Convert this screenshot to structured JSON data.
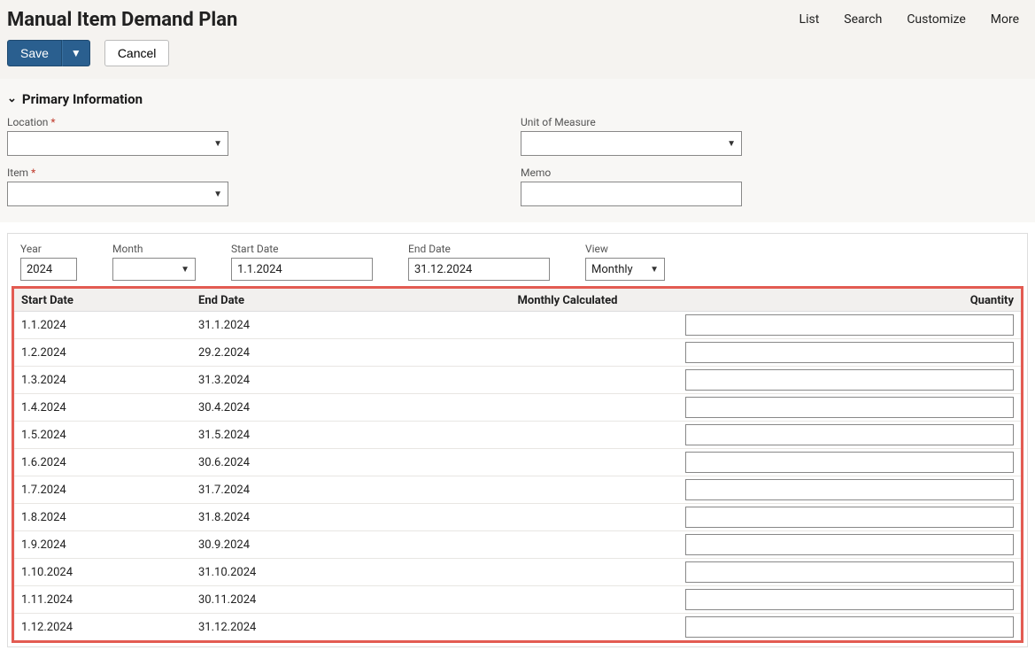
{
  "header": {
    "title": "Manual Item Demand Plan",
    "links": [
      "List",
      "Search",
      "Customize",
      "More"
    ],
    "save_label": "Save",
    "cancel_label": "Cancel"
  },
  "section": {
    "title": "Primary Information",
    "fields": {
      "location": {
        "label": "Location",
        "required": true,
        "value": ""
      },
      "item": {
        "label": "Item",
        "required": true,
        "value": ""
      },
      "uom": {
        "label": "Unit of Measure",
        "required": false,
        "value": ""
      },
      "memo": {
        "label": "Memo",
        "required": false,
        "value": ""
      }
    }
  },
  "filters": {
    "year": {
      "label": "Year",
      "value": "2024"
    },
    "month": {
      "label": "Month",
      "value": ""
    },
    "start_date": {
      "label": "Start Date",
      "value": "1.1.2024"
    },
    "end_date": {
      "label": "End Date",
      "value": "31.12.2024"
    },
    "view": {
      "label": "View",
      "value": "Monthly"
    }
  },
  "grid": {
    "columns": [
      "Start Date",
      "End Date",
      "Monthly Calculated",
      "Quantity"
    ],
    "rows": [
      {
        "start": "1.1.2024",
        "end": "31.1.2024",
        "calc": "",
        "qty": ""
      },
      {
        "start": "1.2.2024",
        "end": "29.2.2024",
        "calc": "",
        "qty": ""
      },
      {
        "start": "1.3.2024",
        "end": "31.3.2024",
        "calc": "",
        "qty": ""
      },
      {
        "start": "1.4.2024",
        "end": "30.4.2024",
        "calc": "",
        "qty": ""
      },
      {
        "start": "1.5.2024",
        "end": "31.5.2024",
        "calc": "",
        "qty": ""
      },
      {
        "start": "1.6.2024",
        "end": "30.6.2024",
        "calc": "",
        "qty": ""
      },
      {
        "start": "1.7.2024",
        "end": "31.7.2024",
        "calc": "",
        "qty": ""
      },
      {
        "start": "1.8.2024",
        "end": "31.8.2024",
        "calc": "",
        "qty": ""
      },
      {
        "start": "1.9.2024",
        "end": "30.9.2024",
        "calc": "",
        "qty": ""
      },
      {
        "start": "1.10.2024",
        "end": "31.10.2024",
        "calc": "",
        "qty": ""
      },
      {
        "start": "1.11.2024",
        "end": "30.11.2024",
        "calc": "",
        "qty": ""
      },
      {
        "start": "1.12.2024",
        "end": "31.12.2024",
        "calc": "",
        "qty": ""
      }
    ]
  }
}
